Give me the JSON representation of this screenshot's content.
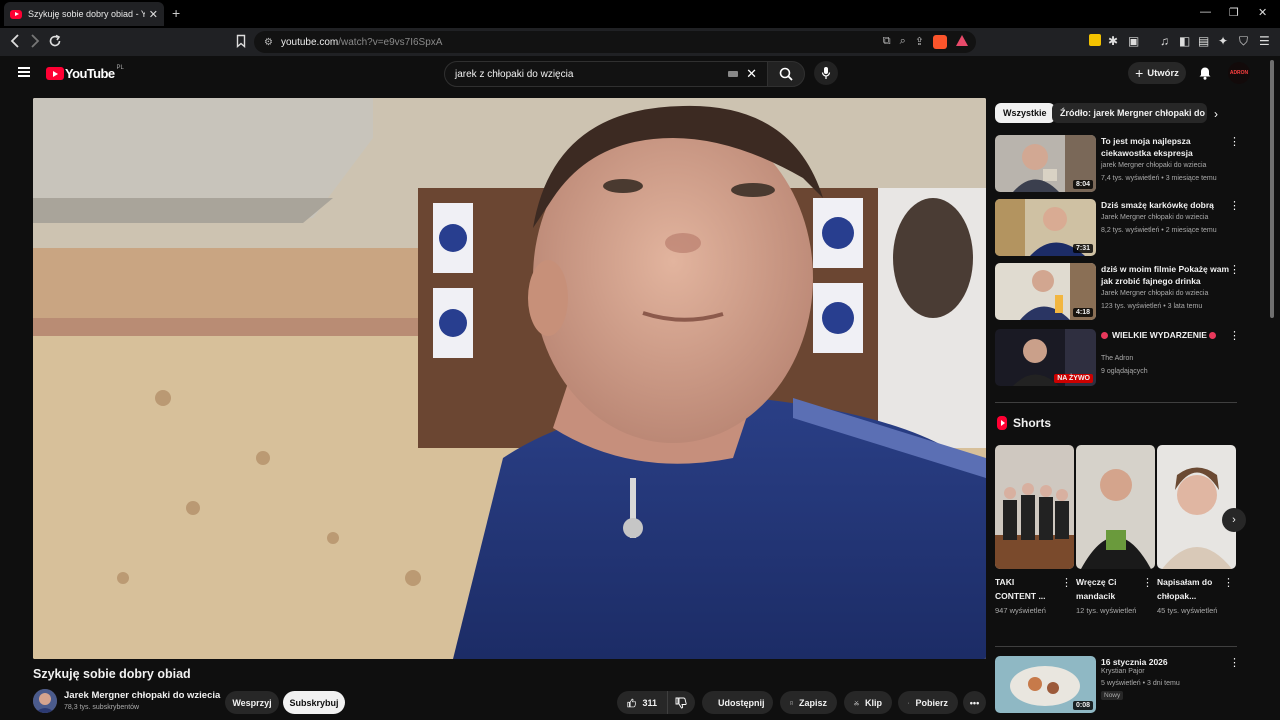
{
  "browser": {
    "tab_title": "Szykuję sobie dobry obiad - You",
    "tab_close": "✕",
    "new_tab": "+",
    "url_host": "youtube.com",
    "url_path": "/watch?v=e9vs7I6SpxA",
    "window_controls": [
      "—",
      "❐",
      "✕"
    ]
  },
  "header": {
    "logo_text": "YouTube",
    "country_code": "PL",
    "search_query": "jarek z chłopaki do wzięcia",
    "create_label": "Utwórz",
    "avatar_text": "ADRON"
  },
  "video": {
    "title": "Szykuję sobie dobry obiad",
    "channel_name": "Jarek Mergner chłopaki do wziecia",
    "subscribers": "78,3 tys. subskrybentów",
    "support_label": "Wesprzyj",
    "subscribe_label": "Subskrybuj",
    "likes": "311",
    "share_label": "Udostępnij",
    "save_label": "Zapisz",
    "clip_label": "Klip",
    "download_label": "Pobierz"
  },
  "sidebar": {
    "chips": [
      "Wszystkie",
      "Źródło: jarek Mergner chłopaki do wzięcia"
    ],
    "recommendations": [
      {
        "title": "To jest moja najlepsza ciekawostka ekspresja",
        "channel": "jarek Mergner chłopaki do wziecia",
        "meta": "7,4 tys. wyświetleń • 3 miesiące temu",
        "duration": "8:04"
      },
      {
        "title": "Dziś smażę karkówkę dobrą",
        "channel": "Jarek Mergner chłopaki do wziecia",
        "meta": "8,2 tys. wyświetleń • 2 miesiące temu",
        "duration": "7:31"
      },
      {
        "title": "dziś w moim filmie Pokażę wam jak zrobić fajnego drinka",
        "channel": "Jarek Mergner chłopaki do wziecia",
        "meta": "123 tys. wyświetleń • 3 lata temu",
        "duration": "4:18"
      },
      {
        "title": "WIELKIE WYDARZENIE",
        "channel": "The Adron",
        "meta": "9 oglądających",
        "live_label": "NA ŻYWO"
      }
    ],
    "shorts_title": "Shorts",
    "shorts": [
      {
        "title": "TAKI CONTENT ...",
        "views": "947 wyświetleń"
      },
      {
        "title": "Wręczę Ci mandacik",
        "views": "12 tys. wyświetleń"
      },
      {
        "title": "Napisałam do chłopak...",
        "views": "45 tys. wyświetleń"
      }
    ],
    "bottom_rec": {
      "title": "16 stycznia 2026",
      "channel": "Krystian Pajor",
      "meta": "5 wyświetleń • 3 dni temu",
      "badge": "Nowy",
      "duration": "0:08"
    }
  },
  "colors": {
    "accent": "#ff0033",
    "background": "#0f0f0f",
    "chip_bg": "#272727"
  }
}
